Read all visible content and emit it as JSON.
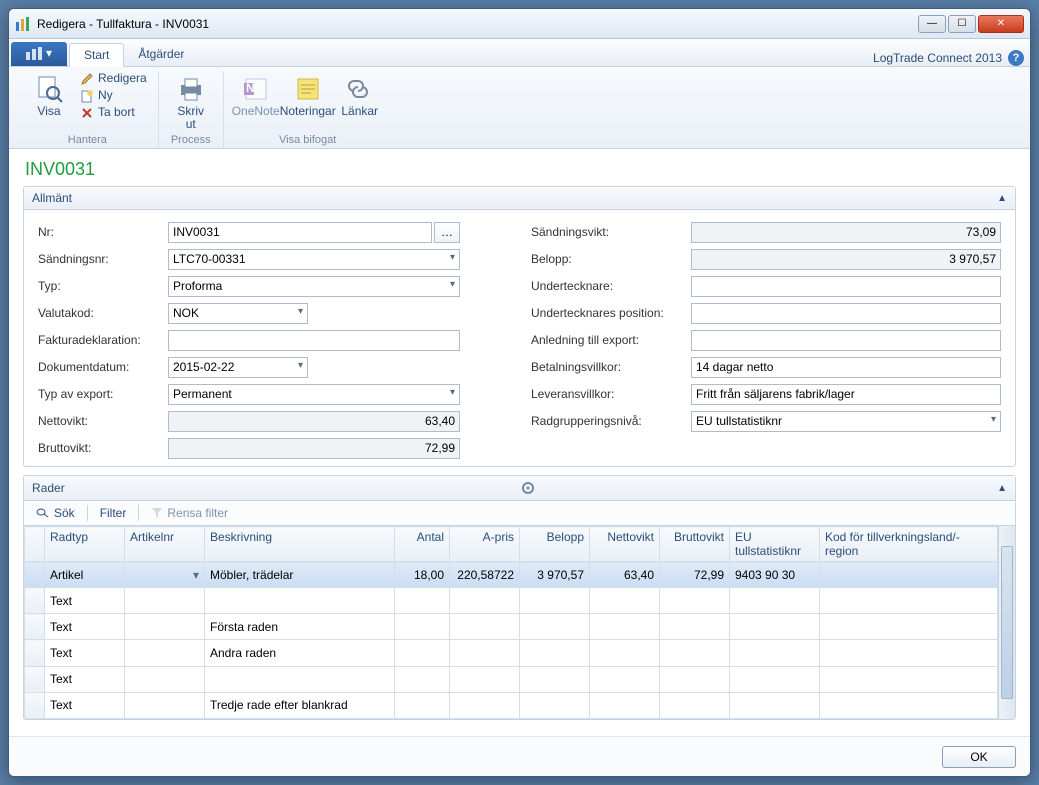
{
  "window": {
    "title": "Redigera - Tullfaktura - INV0031"
  },
  "tabs": {
    "start": "Start",
    "actions": "Åtgärder",
    "brand": "LogTrade Connect 2013"
  },
  "ribbon": {
    "visa": "Visa",
    "redigera": "Redigera",
    "ny": "Ny",
    "tabort": "Ta bort",
    "hantera": "Hantera",
    "skriv_ut": "Skriv\nut",
    "process": "Process",
    "onenote": "OneNote",
    "noteringar": "Noteringar",
    "lankar": "Länkar",
    "visa_bifogat": "Visa bifogat"
  },
  "page_title": "INV0031",
  "sections": {
    "allmant": "Allmänt",
    "rader": "Rader"
  },
  "labels": {
    "nr": "Nr:",
    "sandningsnr": "Sändningsnr:",
    "typ": "Typ:",
    "valutakod": "Valutakod:",
    "fakturadeklaration": "Fakturadeklaration:",
    "dokumentdatum": "Dokumentdatum:",
    "typ_export": "Typ av export:",
    "nettovikt": "Nettovikt:",
    "bruttovikt": "Bruttovikt:",
    "sandningsvikt": "Sändningsvikt:",
    "belopp": "Belopp:",
    "undertecknare": "Undertecknare:",
    "undertecknares_position": "Undertecknares position:",
    "anledning_export": "Anledning till export:",
    "betalningsvillkor": "Betalningsvillkor:",
    "leveransvillkor": "Leveransvillkor:",
    "radgrupperingsniva": "Radgrupperingsnivå:"
  },
  "values": {
    "nr": "INV0031",
    "sandningsnr": "LTC70-00331",
    "typ": "Proforma",
    "valutakod": "NOK",
    "fakturadeklaration": "",
    "dokumentdatum": "2015-02-22",
    "typ_export": "Permanent",
    "nettovikt": "63,40",
    "bruttovikt": "72,99",
    "sandningsvikt": "73,09",
    "belopp": "3 970,57",
    "undertecknare": "",
    "undertecknares_position": "",
    "anledning_export": "",
    "betalningsvillkor": "14 dagar netto",
    "leveransvillkor": "Fritt från säljarens fabrik/lager",
    "radgrupperingsniva": "EU tullstatistiknr"
  },
  "rader_toolbar": {
    "sok": "Sök",
    "filter": "Filter",
    "rensa": "Rensa filter"
  },
  "columns": {
    "radtyp": "Radtyp",
    "artikelnr": "Artikelnr",
    "beskrivning": "Beskrivning",
    "antal": "Antal",
    "a_pris": "A-pris",
    "belopp": "Belopp",
    "nettovikt": "Nettovikt",
    "bruttovikt": "Bruttovikt",
    "eu": "EU tullstatistiknr",
    "kod": "Kod för tillverkningsland/-region"
  },
  "rows": [
    {
      "radtyp": "Artikel",
      "artikelnr": "",
      "beskrivning": "Möbler, trädelar",
      "antal": "18,00",
      "a_pris": "220,58722",
      "belopp": "3 970,57",
      "nettovikt": "63,40",
      "bruttovikt": "72,99",
      "eu": "9403 90 30",
      "kod": ""
    },
    {
      "radtyp": "Text",
      "artikelnr": "",
      "beskrivning": "",
      "antal": "",
      "a_pris": "",
      "belopp": "",
      "nettovikt": "",
      "bruttovikt": "",
      "eu": "",
      "kod": ""
    },
    {
      "radtyp": "Text",
      "artikelnr": "",
      "beskrivning": "Första raden",
      "antal": "",
      "a_pris": "",
      "belopp": "",
      "nettovikt": "",
      "bruttovikt": "",
      "eu": "",
      "kod": ""
    },
    {
      "radtyp": "Text",
      "artikelnr": "",
      "beskrivning": "Andra raden",
      "antal": "",
      "a_pris": "",
      "belopp": "",
      "nettovikt": "",
      "bruttovikt": "",
      "eu": "",
      "kod": ""
    },
    {
      "radtyp": "Text",
      "artikelnr": "",
      "beskrivning": "",
      "antal": "",
      "a_pris": "",
      "belopp": "",
      "nettovikt": "",
      "bruttovikt": "",
      "eu": "",
      "kod": ""
    },
    {
      "radtyp": "Text",
      "artikelnr": "",
      "beskrivning": "Tredje rade efter blankrad",
      "antal": "",
      "a_pris": "",
      "belopp": "",
      "nettovikt": "",
      "bruttovikt": "",
      "eu": "",
      "kod": ""
    }
  ],
  "footer": {
    "ok": "OK"
  }
}
